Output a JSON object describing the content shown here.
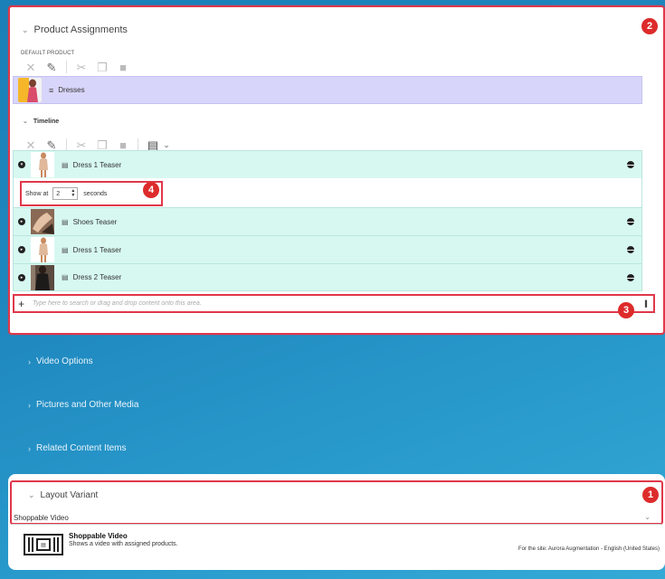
{
  "product_assignments": {
    "title": "Product Assignments",
    "default_product_label": "DEFAULT PRODUCT",
    "default_product_item": "Dresses",
    "timeline_label": "Timeline",
    "timeline_items": [
      {
        "label": "Dress 1 Teaser",
        "expanded": true,
        "show_at_label": "Show at",
        "show_at_value": "2",
        "seconds_label": "seconds"
      },
      {
        "label": "Shoes Teaser",
        "expanded": false
      },
      {
        "label": "Dress 1 Teaser",
        "expanded": false
      },
      {
        "label": "Dress 2 Teaser",
        "expanded": false
      }
    ],
    "search_placeholder": "Type here to search or drag and drop content onto this area."
  },
  "collapsed_sections": [
    "Video Options",
    "Pictures and Other Media",
    "Related Content Items"
  ],
  "layout_variant": {
    "title": "Layout Variant",
    "selected": "Shoppable Video",
    "variant_title": "Shoppable Video",
    "variant_description": "Shows a video with assigned products.",
    "site_note": "For the site: Aurora Augmentation - English (United States)"
  },
  "badges": {
    "layout_variant": "1",
    "product_assignments": "2",
    "search": "3",
    "show_at": "4"
  },
  "icons": {
    "toolbar": [
      "close-icon",
      "edit-icon",
      "cut-icon",
      "copy-icon",
      "paste-icon"
    ],
    "timeline_toolbar_extra": [
      "new-content-icon",
      "chevron-down-icon"
    ]
  },
  "colors": {
    "accent_red": "#e0384a",
    "badge_red": "#dd2b2b",
    "default_row": "#d8d5fa",
    "timeline_row": "#d7f8f1"
  }
}
